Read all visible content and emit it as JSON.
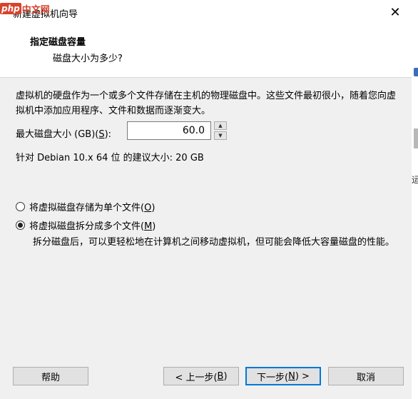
{
  "window": {
    "title": "新建虚拟机向导",
    "close_glyph": "✕"
  },
  "watermark": {
    "brand": "php",
    "text": "中文网"
  },
  "header": {
    "title": "指定磁盘容量",
    "subtitle": "磁盘大小为多少?"
  },
  "description": "虚拟机的硬盘作为一个或多个文件存储在主机的物理磁盘中。这些文件最初很小，随着您向虚拟机中添加应用程序、文件和数据而逐渐变大。",
  "disk_size": {
    "label_prefix": "最大磁盘大小 (GB)(",
    "label_key": "S",
    "label_suffix": "):",
    "value": "60.0"
  },
  "recommendation": "针对 Debian 10.x 64 位 的建议大小: 20 GB",
  "options": [
    {
      "label_prefix": "将虚拟磁盘存储为单个文件(",
      "label_key": "O",
      "label_suffix": ")",
      "selected": false
    },
    {
      "label_prefix": "将虚拟磁盘拆分成多个文件(",
      "label_key": "M",
      "label_suffix": ")",
      "selected": true
    }
  ],
  "split_description": "拆分磁盘后，可以更轻松地在计算机之间移动虚拟机，但可能会降低大容量磁盘的性能。",
  "buttons": {
    "help": "帮助",
    "back": {
      "prefix": "< 上一步(",
      "key": "B",
      "suffix": ")"
    },
    "next": {
      "prefix": "下一步(",
      "key": "N",
      "suffix": ") >"
    },
    "cancel": "取消"
  },
  "right_strip_text": "运"
}
